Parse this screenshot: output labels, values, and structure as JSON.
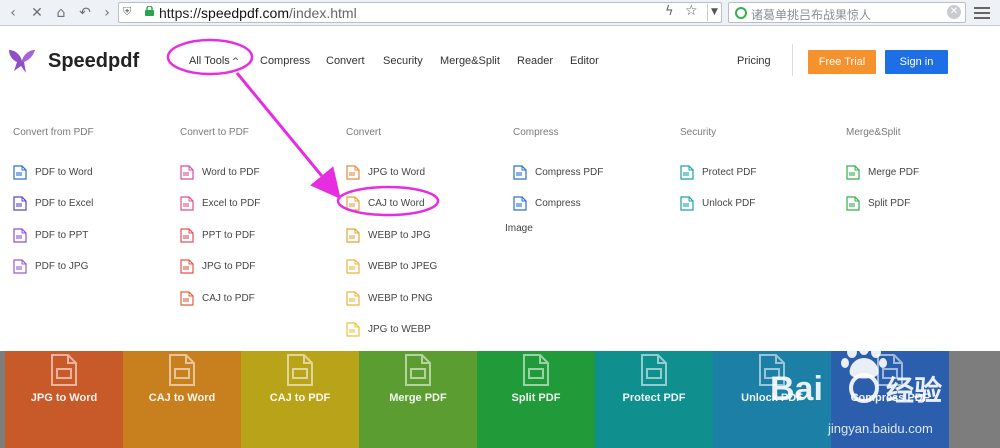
{
  "browser": {
    "url_scheme": "https://",
    "url_host": "speedpdf.com",
    "url_path": "/index.html",
    "search_placeholder": "诸葛单挑吕布战果惊人"
  },
  "header": {
    "brand": "Speedpdf",
    "nav": [
      {
        "label": "All Tools"
      },
      {
        "label": "Compress"
      },
      {
        "label": "Convert"
      },
      {
        "label": "Security"
      },
      {
        "label": "Merge&Split"
      },
      {
        "label": "Reader"
      },
      {
        "label": "Editor"
      }
    ],
    "pricing": "Pricing",
    "free_trial": "Free Trial",
    "sign_in": "Sign in",
    "colors": {
      "free_trial": "#f5922b",
      "sign_in": "#1e6ee6"
    }
  },
  "dropdown": {
    "columns": [
      {
        "title": "Convert from PDF",
        "items": [
          {
            "label": "PDF to Word",
            "icon": "word-doc-icon",
            "color": "#2b6fd6"
          },
          {
            "label": "PDF to Excel",
            "icon": "excel-doc-icon",
            "color": "#5b47c7"
          },
          {
            "label": "PDF to PPT",
            "icon": "ppt-doc-icon",
            "color": "#8a4fd8"
          },
          {
            "label": "PDF to JPG",
            "icon": "image-doc-icon",
            "color": "#9b59d0"
          }
        ]
      },
      {
        "title": "Convert to PDF",
        "items": [
          {
            "label": "Word to PDF",
            "icon": "word-to-pdf-icon",
            "color": "#d64fa0"
          },
          {
            "label": "Excel to PDF",
            "icon": "excel-to-pdf-icon",
            "color": "#e0508f"
          },
          {
            "label": "PPT to PDF",
            "icon": "ppt-to-pdf-icon",
            "color": "#e0505a"
          },
          {
            "label": "JPG to PDF",
            "icon": "jpg-to-pdf-icon",
            "color": "#e35448"
          },
          {
            "label": "CAJ to PDF",
            "icon": "caj-to-pdf-icon",
            "color": "#e0603a"
          }
        ]
      },
      {
        "title": "Convert",
        "items": [
          {
            "label": "JPG to Word",
            "icon": "jpg-to-word-icon",
            "color": "#e88a3a"
          },
          {
            "label": "CAJ to Word",
            "icon": "caj-to-word-icon",
            "color": "#e8a23a"
          },
          {
            "label": "WEBP to JPG",
            "icon": "webp-to-jpg-icon",
            "color": "#e8a23a"
          },
          {
            "label": "WEBP to JPEG",
            "icon": "webp-to-jpeg-icon",
            "color": "#ecb43a"
          },
          {
            "label": "WEBP to PNG",
            "icon": "webp-to-png-icon",
            "color": "#ecb43a"
          },
          {
            "label": "JPG to WEBP",
            "icon": "jpg-to-webp-icon",
            "color": "#ecc23a"
          }
        ]
      },
      {
        "title": "Compress",
        "items": [
          {
            "label": "Compress PDF",
            "icon": "compress-pdf-icon",
            "color": "#2b6fd6"
          },
          {
            "label": "Compress",
            "icon": "compress-image-icon",
            "color": "#2b6fd6"
          }
        ],
        "extra_label": "Image"
      },
      {
        "title": "Security",
        "items": [
          {
            "label": "Protect PDF",
            "icon": "lock-doc-icon",
            "color": "#17a5a5"
          },
          {
            "label": "Unlock PDF",
            "icon": "unlock-doc-icon",
            "color": "#17a5a5"
          }
        ]
      },
      {
        "title": "Merge&Split",
        "items": [
          {
            "label": "Merge PDF",
            "icon": "merge-icon",
            "color": "#33b14d"
          },
          {
            "label": "Split PDF",
            "icon": "split-icon",
            "color": "#33b14d"
          }
        ]
      }
    ]
  },
  "tiles": [
    {
      "label": "JPG to Word",
      "color": "#c85a2a",
      "icon": "image-tile-icon"
    },
    {
      "label": "CAJ to Word",
      "color": "#c8801f",
      "icon": "layers-tile-icon"
    },
    {
      "label": "CAJ to PDF",
      "color": "#b9a419",
      "icon": "pdf-tile-icon"
    },
    {
      "label": "Merge PDF",
      "color": "#5c9d31",
      "icon": "merge-tile-icon"
    },
    {
      "label": "Split PDF",
      "color": "#219a3a",
      "icon": "split-tile-icon"
    },
    {
      "label": "Protect PDF",
      "color": "#108f8f",
      "icon": "lock-tile-icon"
    },
    {
      "label": "Unlock PDF",
      "color": "#1b7fa6",
      "icon": "unlock-tile-icon"
    },
    {
      "label": "Compress PDF",
      "color": "#2b5fae",
      "icon": "compress-tile-icon"
    }
  ],
  "watermark": {
    "text": "jingyan.baidu.com"
  }
}
